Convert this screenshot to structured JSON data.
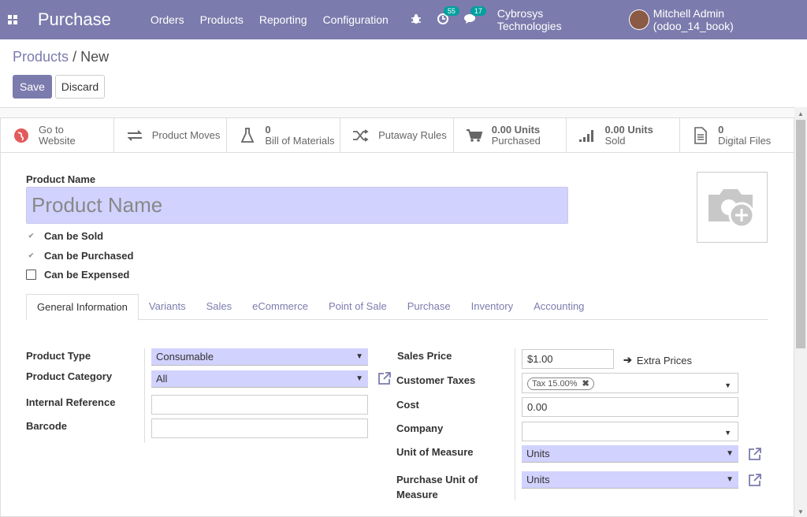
{
  "navbar": {
    "brand": "Purchase",
    "menu": [
      "Orders",
      "Products",
      "Reporting",
      "Configuration"
    ],
    "activity_count": "55",
    "message_count": "17",
    "company": "Cybrosys Technologies",
    "user": "Mitchell Admin (odoo_14_book)"
  },
  "breadcrumb": {
    "parent": "Products",
    "separator": "/",
    "current": "New"
  },
  "buttons": {
    "save": "Save",
    "discard": "Discard"
  },
  "smart_buttons": [
    {
      "value": "",
      "label": "Go to Website",
      "line1": "Go to",
      "line2": "Website",
      "icon": "globe-icon"
    },
    {
      "value": "",
      "label": "Product Moves",
      "icon": "exchange-icon"
    },
    {
      "value": "0",
      "label": "Bill of Materials",
      "icon": "flask-icon"
    },
    {
      "value": "",
      "label": "Putaway Rules",
      "icon": "random-icon"
    },
    {
      "value": "0.00 Units",
      "label": "Purchased",
      "icon": "cart-icon"
    },
    {
      "value": "0.00 Units",
      "label": "Sold",
      "icon": "signal-icon"
    },
    {
      "value": "0",
      "label": "Digital Files",
      "icon": "file-icon"
    }
  ],
  "product": {
    "name_label": "Product Name",
    "name_placeholder": "Product Name",
    "can_be_sold": "Can be Sold",
    "can_be_purchased": "Can be Purchased",
    "can_be_expensed": "Can be Expensed"
  },
  "tabs": [
    "General Information",
    "Variants",
    "Sales",
    "eCommerce",
    "Point of Sale",
    "Purchase",
    "Inventory",
    "Accounting"
  ],
  "general": {
    "product_type_label": "Product Type",
    "product_type_value": "Consumable",
    "product_category_label": "Product Category",
    "product_category_value": "All",
    "internal_reference_label": "Internal Reference",
    "barcode_label": "Barcode",
    "sales_price_label": "Sales Price",
    "sales_price_value": "$1.00",
    "extra_prices": "Extra Prices",
    "customer_taxes_label": "Customer Taxes",
    "customer_taxes_tag": "Tax 15.00%",
    "cost_label": "Cost",
    "cost_value": "0.00",
    "company_label": "Company",
    "uom_label": "Unit of Measure",
    "uom_value": "Units",
    "purchase_uom_label_1": "Purchase Unit of",
    "purchase_uom_label_2": "Measure",
    "purchase_uom_value": "Units"
  },
  "colors": {
    "brand": "#7c7bad",
    "required_field": "#d2d2ff",
    "badge": "#00a09d"
  }
}
